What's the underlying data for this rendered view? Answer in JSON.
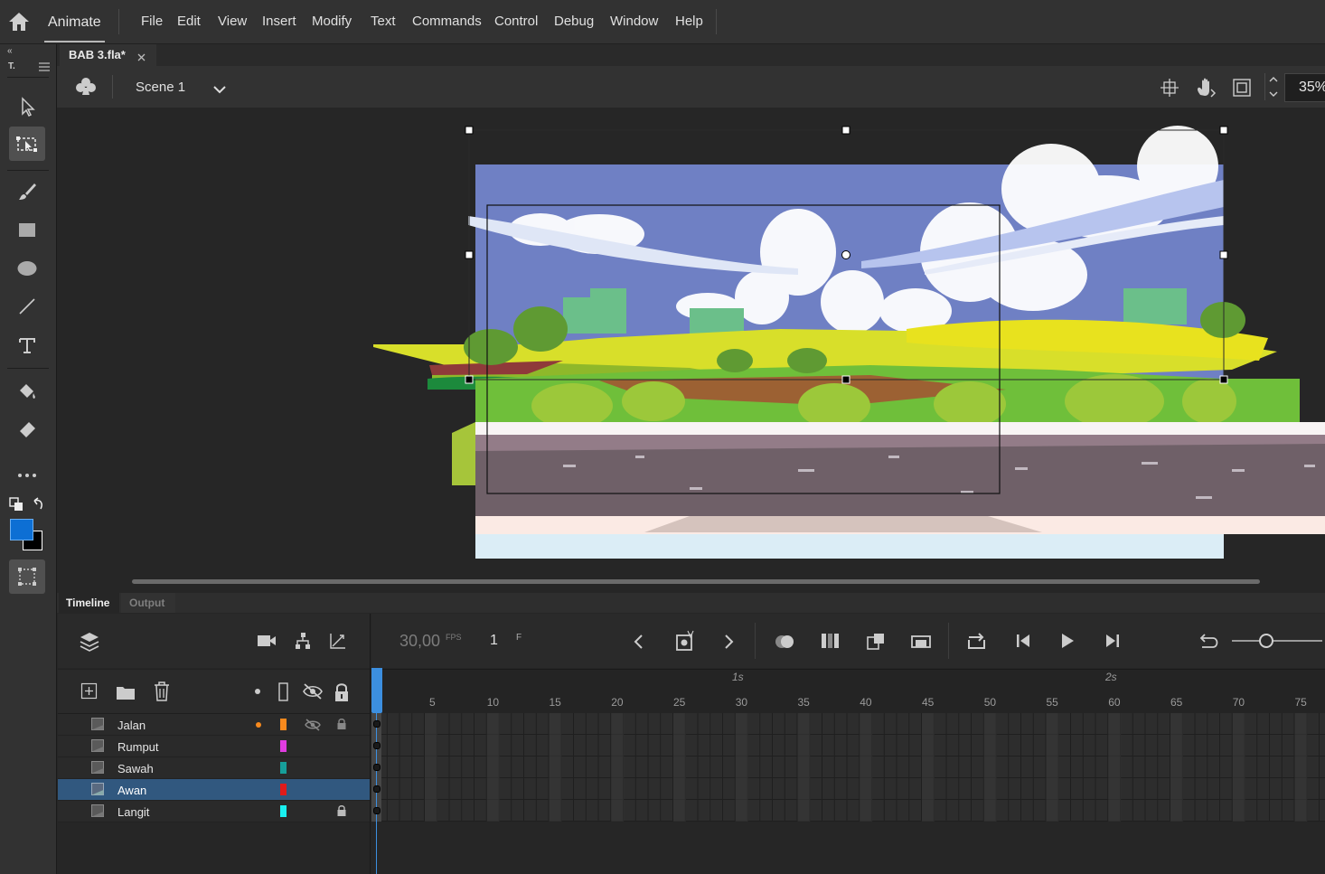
{
  "app": {
    "name": "Animate"
  },
  "menu": [
    "File",
    "Edit",
    "View",
    "Insert",
    "Modify",
    "Text",
    "Commands",
    "Control",
    "Debug",
    "Window",
    "Help"
  ],
  "document": {
    "tab_title": "BAB 3.fla*"
  },
  "toolbar_header": {
    "label": "T."
  },
  "scene": {
    "name": "Scene 1",
    "zoom": "35%"
  },
  "colors": {
    "fill": "#0d6fd4",
    "stroke": "#000000",
    "selection_layer": "#31587f",
    "accent": "#3c8fe0"
  },
  "panels": {
    "timeline_tab": "Timeline",
    "output_tab": "Output"
  },
  "timeline": {
    "fps": "30,00",
    "fps_unit": "FPS",
    "current_frame": "1",
    "frame_unit": "F",
    "second_markers": [
      "1s",
      "2s"
    ],
    "ruler": [
      "5",
      "10",
      "15",
      "20",
      "25",
      "30",
      "35",
      "40",
      "45",
      "50",
      "55",
      "60",
      "65",
      "70",
      "75"
    ]
  },
  "layers": [
    {
      "name": "Jalan",
      "color": "#f7891d",
      "selected": false,
      "active": true,
      "hidden": true,
      "locked": true
    },
    {
      "name": "Rumput",
      "color": "#e03ce0",
      "selected": false,
      "active": false,
      "hidden": false,
      "locked": false
    },
    {
      "name": "Sawah",
      "color": "#169e9a",
      "selected": false,
      "active": false,
      "hidden": false,
      "locked": false
    },
    {
      "name": "Awan",
      "color": "#e01b1b",
      "selected": true,
      "active": false,
      "hidden": false,
      "locked": false
    },
    {
      "name": "Langit",
      "color": "#19f0f0",
      "selected": false,
      "active": false,
      "hidden": false,
      "locked": true
    }
  ],
  "icons": {
    "home": "home-icon",
    "close": "close-icon",
    "scene": "club-icon",
    "dropdown": "chevron-down-icon",
    "snap": "crosshair-icon",
    "hand": "hand-icon",
    "fit": "fit-stage-icon",
    "layers": "layers-icon",
    "camera": "camera-icon",
    "parent": "hierarchy-icon",
    "graph": "graph-icon",
    "new_layer": "add-layer-icon",
    "folder": "folder-icon",
    "delete": "trash-icon",
    "play": "play-icon",
    "step_back": "step-back-icon",
    "step_forward": "step-forward-icon",
    "loop": "loop-icon"
  }
}
